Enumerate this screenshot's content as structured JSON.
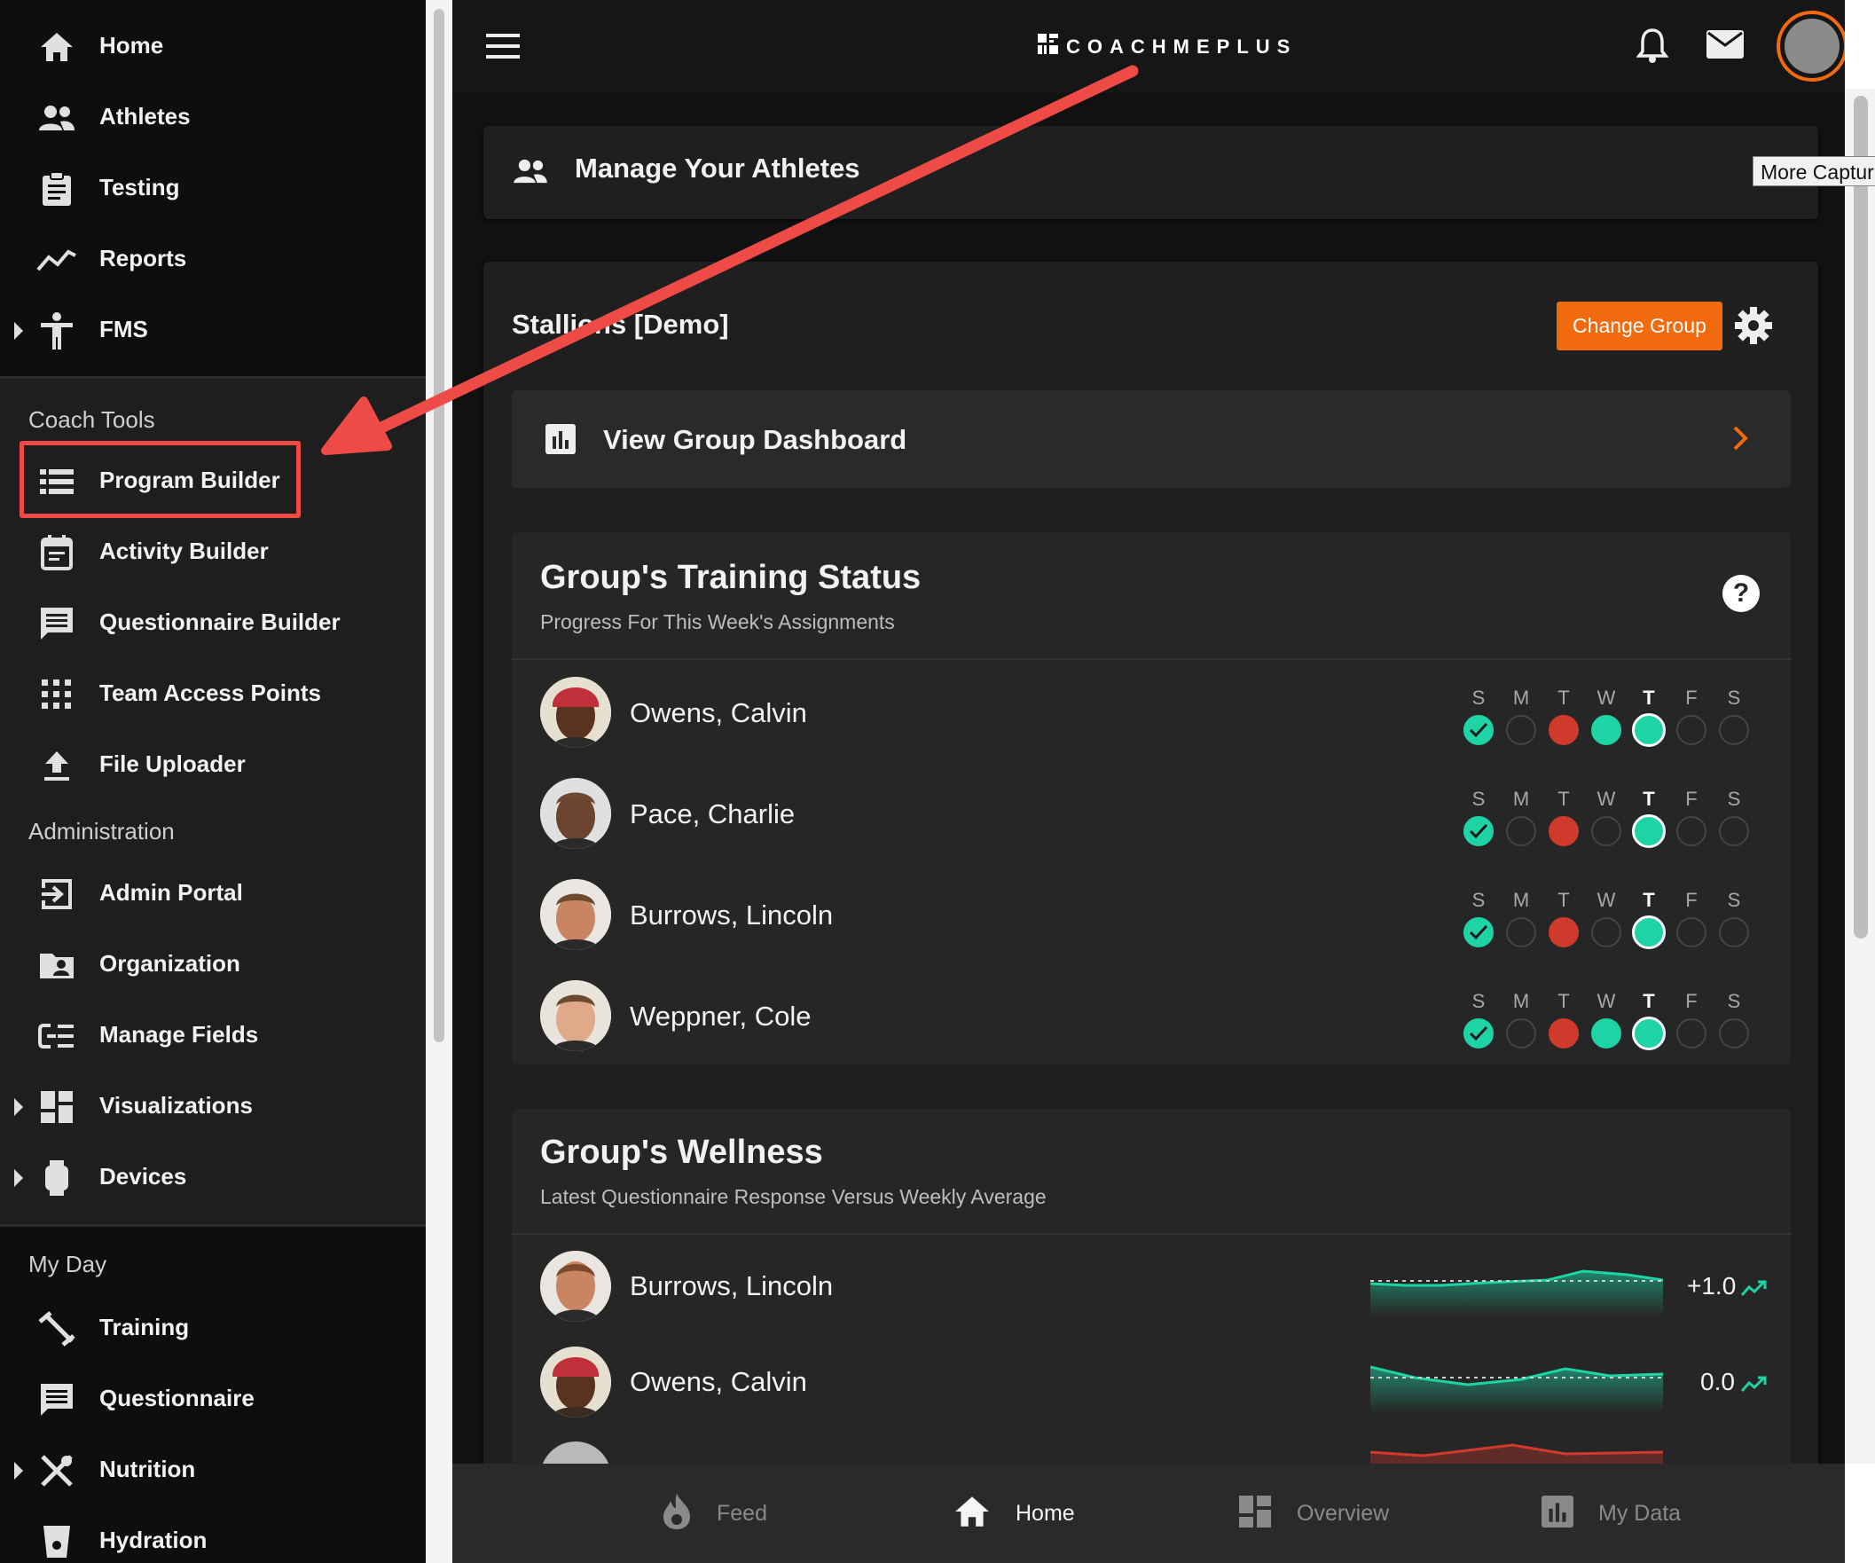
{
  "sidebar": {
    "items": [
      {
        "label": "Home",
        "icon": "home-icon"
      },
      {
        "label": "Athletes",
        "icon": "people-icon"
      },
      {
        "label": "Testing",
        "icon": "clipboard-icon"
      },
      {
        "label": "Reports",
        "icon": "trend-line-icon"
      },
      {
        "label": "FMS",
        "icon": "figure-icon"
      }
    ],
    "coach_tools_heading": "Coach Tools",
    "coach_tools": [
      {
        "label": "Program Builder",
        "icon": "list-icon"
      },
      {
        "label": "Activity Builder",
        "icon": "calendar-icon"
      },
      {
        "label": "Questionnaire Builder",
        "icon": "message-icon"
      },
      {
        "label": "Team Access Points",
        "icon": "grid-dots-icon"
      },
      {
        "label": "File Uploader",
        "icon": "upload-icon"
      }
    ],
    "administration_heading": "Administration",
    "administration": [
      {
        "label": "Admin Portal",
        "icon": "login-icon"
      },
      {
        "label": "Organization",
        "icon": "folder-person-icon"
      },
      {
        "label": "Manage Fields",
        "icon": "fields-list-icon"
      },
      {
        "label": "Visualizations",
        "icon": "dashboard-icon"
      },
      {
        "label": "Devices",
        "icon": "watch-icon"
      }
    ],
    "my_day_heading": "My Day",
    "my_day": [
      {
        "label": "Training",
        "icon": "dumbbell-icon"
      },
      {
        "label": "Questionnaire",
        "icon": "message-icon"
      },
      {
        "label": "Nutrition",
        "icon": "utensils-icon"
      },
      {
        "label": "Hydration",
        "icon": "cup-icon"
      }
    ]
  },
  "header": {
    "logo_text": "COACHMEPLUS"
  },
  "manage_card": {
    "title": "Manage Your Athletes"
  },
  "tooltip": {
    "text": "More Captur"
  },
  "group": {
    "name": "Stallions [Demo]",
    "change_group_label": "Change Group",
    "dashboard_label": "View Group Dashboard"
  },
  "training_status": {
    "title": "Group's Training Status",
    "subtitle": "Progress For This Week's Assignments",
    "days": [
      "S",
      "M",
      "T",
      "W",
      "T",
      "F",
      "S"
    ],
    "today_index": 4,
    "athletes": [
      {
        "name": "Owens, Calvin",
        "status": [
          "done",
          "none",
          "missed",
          "complete",
          "today",
          "none",
          "none"
        ]
      },
      {
        "name": "Pace, Charlie",
        "status": [
          "done",
          "none",
          "missed",
          "none",
          "today",
          "none",
          "none"
        ]
      },
      {
        "name": "Burrows, Lincoln",
        "status": [
          "done",
          "none",
          "missed",
          "none",
          "today",
          "none",
          "none"
        ]
      },
      {
        "name": "Weppner, Cole",
        "status": [
          "done",
          "none",
          "missed",
          "complete",
          "today",
          "none",
          "none"
        ]
      }
    ]
  },
  "wellness": {
    "title": "Group's Wellness",
    "subtitle": "Latest Questionnaire Response Versus Weekly Average",
    "athletes": [
      {
        "name": "Burrows, Lincoln",
        "delta": "+1.0"
      },
      {
        "name": "Owens, Calvin",
        "delta": "0.0"
      }
    ]
  },
  "bottom_nav": [
    {
      "label": "Feed",
      "icon": "flame-icon"
    },
    {
      "label": "Home",
      "icon": "home-icon"
    },
    {
      "label": "Overview",
      "icon": "dashboard-icon"
    },
    {
      "label": "My Data",
      "icon": "bar-chart-icon"
    }
  ],
  "colors": {
    "accent_orange": "#f26a0e",
    "teal": "#1ed3a5",
    "red": "#d03a2c",
    "annotation_red": "#ee4b47"
  }
}
